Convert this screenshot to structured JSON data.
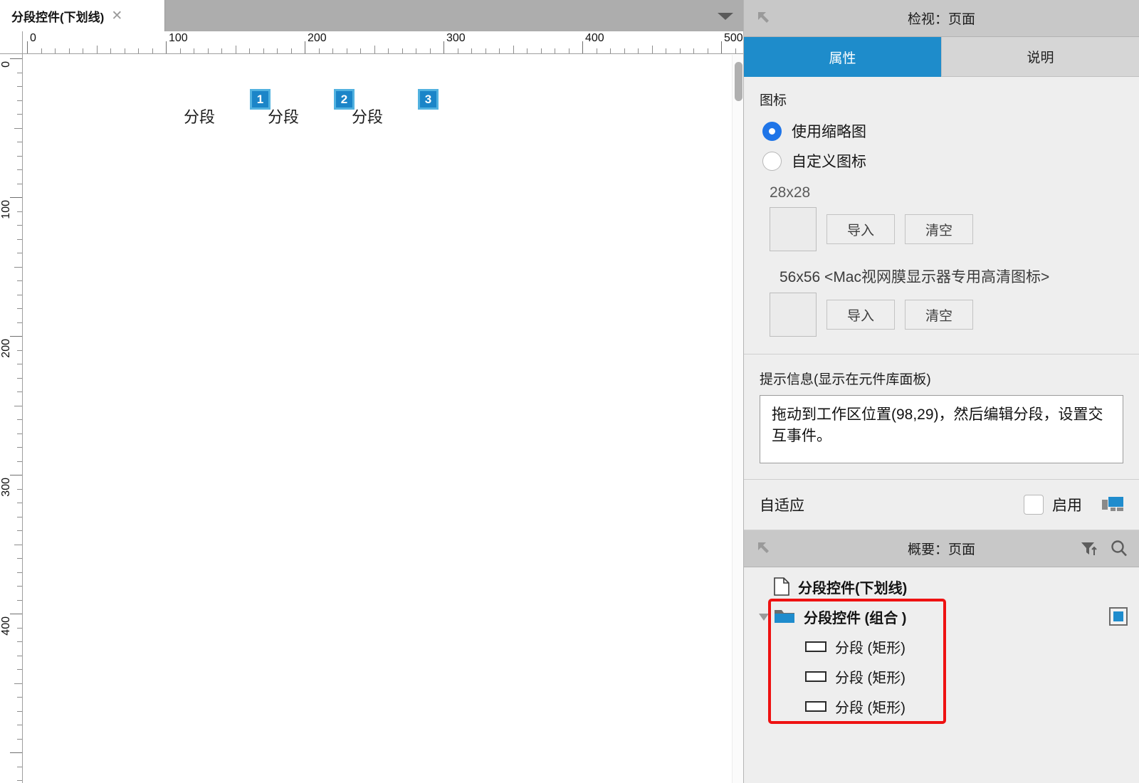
{
  "window": {
    "tab": {
      "title": "分段控件(下划线)",
      "close_icon": "close-icon"
    },
    "tabbar_menu_icon": "chevron-down-icon"
  },
  "ruler": {
    "h_labels": [
      "0",
      "100",
      "200",
      "300",
      "400",
      "500"
    ],
    "v_labels": [
      "0",
      "100",
      "200",
      "300",
      "400"
    ],
    "unit_step": 100,
    "minor_step": 10
  },
  "canvas": {
    "segments": [
      {
        "label": "分段",
        "badge": "1"
      },
      {
        "label": "分段",
        "badge": "2"
      },
      {
        "label": "分段",
        "badge": "3"
      }
    ]
  },
  "inspector": {
    "header": {
      "title": "检视：页面",
      "collapse_icon": "collapse-arrow-icon"
    },
    "tabs": [
      {
        "label": "属性",
        "active": true
      },
      {
        "label": "说明",
        "active": false
      }
    ],
    "icon_section": {
      "title": "图标",
      "options": [
        {
          "label": "使用缩略图",
          "checked": true
        },
        {
          "label": "自定义图标",
          "checked": false
        }
      ],
      "slots": [
        {
          "caption": "28x28",
          "import_label": "导入",
          "clear_label": "清空"
        },
        {
          "caption": "56x56 <Mac视网膜显示器专用高清图标>",
          "import_label": "导入",
          "clear_label": "清空"
        }
      ]
    },
    "tip_section": {
      "title": "提示信息(显示在元件库面板)",
      "value": "拖动到工作区位置(98,29)，然后编辑分段，设置交互事件。"
    },
    "adaptive_section": {
      "label": "自适应",
      "checkbox_label": "启用",
      "checked": false,
      "config_icon": "adaptive-view-icon"
    }
  },
  "outline": {
    "header": {
      "title": "概要：页面",
      "collapse_icon": "collapse-arrow-icon",
      "filter_icon": "filter-sort-icon",
      "search_icon": "search-icon"
    },
    "tree": [
      {
        "label": "分段控件(下划线)",
        "icon": "page-icon",
        "depth": 0,
        "twisty": "none"
      },
      {
        "label": "分段控件 (组合 )",
        "icon": "folder-icon",
        "depth": 0,
        "twisty": "expanded",
        "highlighted": true,
        "marker": true
      },
      {
        "label": "分段 (矩形)",
        "icon": "rectangle-icon",
        "depth": 1,
        "twisty": "none",
        "highlighted": true
      },
      {
        "label": "分段 (矩形)",
        "icon": "rectangle-icon",
        "depth": 1,
        "twisty": "none",
        "highlighted": true
      },
      {
        "label": "分段 (矩形)",
        "icon": "rectangle-icon",
        "depth": 1,
        "twisty": "none",
        "highlighted": true
      }
    ]
  },
  "colors": {
    "accent_blue": "#1e8ccb",
    "badge_fill": "#1b85c8",
    "badge_border": "#52b2e0",
    "radio_blue": "#1f75e8",
    "highlight_red": "#ee1111",
    "panel_bg": "#eeeeee",
    "header_gray": "#c8c8c8",
    "tabbar_gray": "#adadad"
  }
}
